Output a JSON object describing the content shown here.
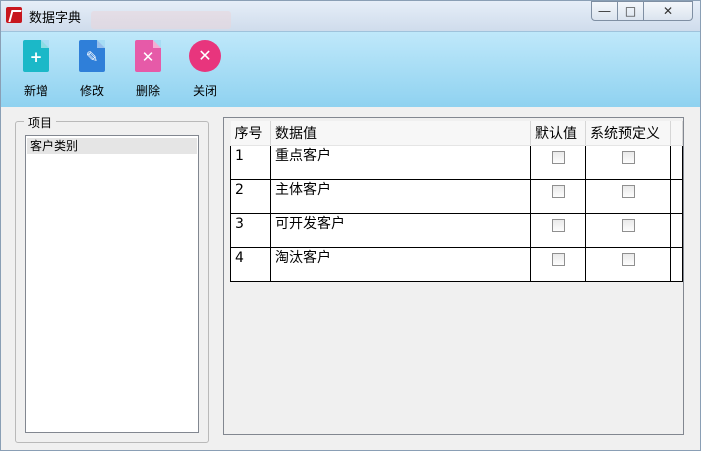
{
  "window": {
    "title": "数据字典"
  },
  "toolbar": {
    "add_label": "新增",
    "edit_label": "修改",
    "delete_label": "删除",
    "close_label": "关闭"
  },
  "sidebar": {
    "legend": "项目",
    "items": [
      {
        "label": "客户类别"
      }
    ]
  },
  "grid": {
    "columns": [
      "序号",
      "数据值",
      "默认值",
      "系统预定义"
    ],
    "rows": [
      {
        "index": "1",
        "value": "重点客户",
        "default": false,
        "predefined": false
      },
      {
        "index": "2",
        "value": "主体客户",
        "default": false,
        "predefined": false
      },
      {
        "index": "3",
        "value": "可开发客户",
        "default": false,
        "predefined": false
      },
      {
        "index": "4",
        "value": "淘汰客户",
        "default": false,
        "predefined": false
      }
    ]
  },
  "colors": {
    "toolbar": "#a6dcf4",
    "add": "#1bb8c8",
    "edit": "#2f7fd9",
    "delete": "#e65aa8",
    "close": "#e8357d"
  }
}
